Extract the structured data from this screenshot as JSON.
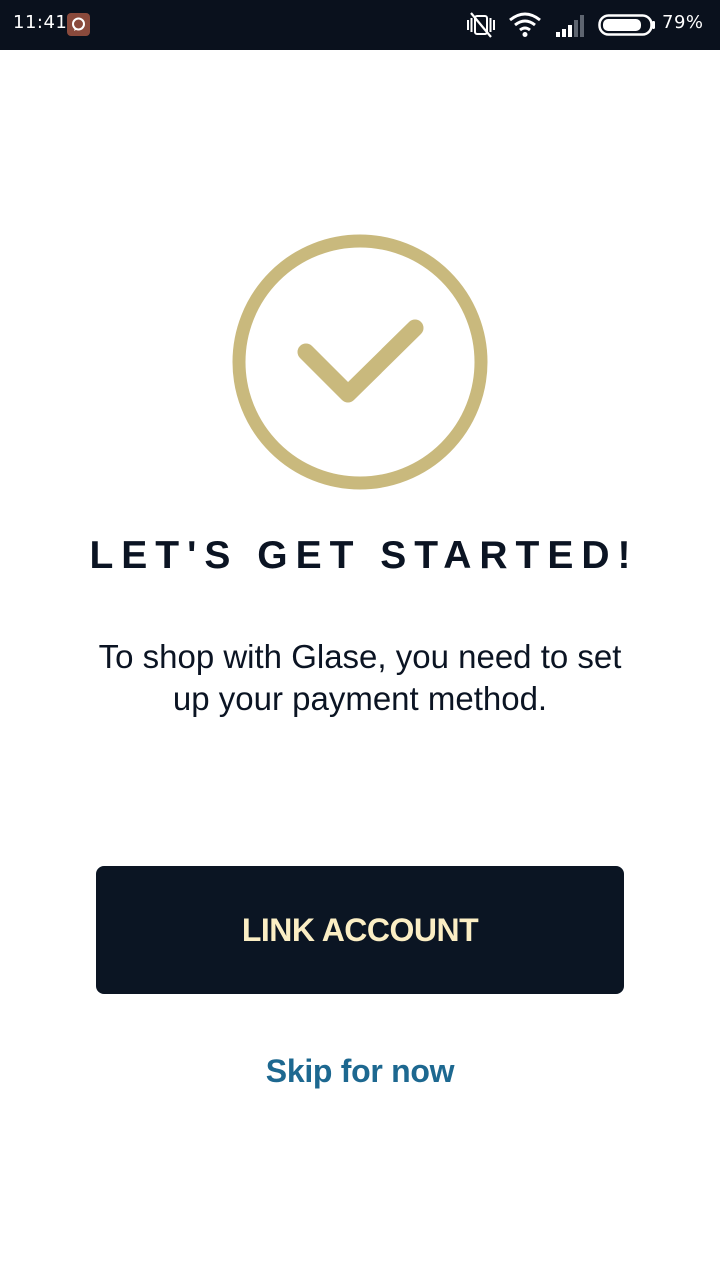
{
  "status_bar": {
    "time": "11:41",
    "battery_percent": "79%",
    "icons": [
      "notification-icon",
      "vibrate-off-icon",
      "wifi-icon",
      "cellular-signal-icon",
      "battery-icon"
    ]
  },
  "colors": {
    "accent_gold": "#c9b97d",
    "dark_navy": "#0b1523",
    "button_text": "#fbeec4",
    "link_blue": "#1d6890"
  },
  "main": {
    "graphic_icon": "checkmark-circle-icon",
    "heading": "LET'S GET STARTED!",
    "description": "To shop with Glase, you need to set up your payment method.",
    "primary_button": "LINK ACCOUNT",
    "secondary_link": "Skip for now"
  }
}
